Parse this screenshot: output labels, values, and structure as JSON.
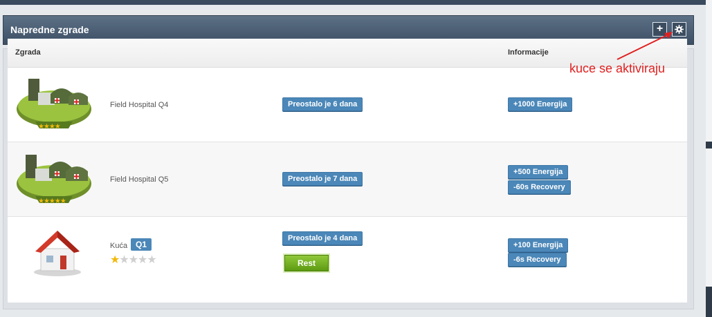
{
  "panel": {
    "title": "Napredne zgrade",
    "add_icon": "plus-icon",
    "settings_icon": "gear-icon"
  },
  "table": {
    "col_building": "Zgrada",
    "col_info": "Informacije"
  },
  "rows": [
    {
      "name": "Field Hospital Q4",
      "remaining": "Preostalo je 6 dana",
      "info": [
        "+1000 Energija"
      ],
      "stars": 4
    },
    {
      "name": "Field Hospital Q5",
      "remaining": "Preostalo je 7 dana",
      "info": [
        "+500 Energija",
        "-60s Recovery"
      ],
      "stars": 5
    },
    {
      "name": "Kuća",
      "quality": "Q1",
      "remaining": "Preostalo je 4 dana",
      "action": "Rest",
      "info": [
        "+100 Energija",
        "-6s Recovery"
      ],
      "stars": 1
    }
  ],
  "annotation": {
    "text": "kuce se aktiviraju",
    "color": "#e02020"
  },
  "colors": {
    "header_top": "#5c7086",
    "header_bottom": "#3d4f64",
    "tag_blue": "#4b87b8",
    "rest_green": "#76b225",
    "star_gold": "#f2b90a"
  }
}
